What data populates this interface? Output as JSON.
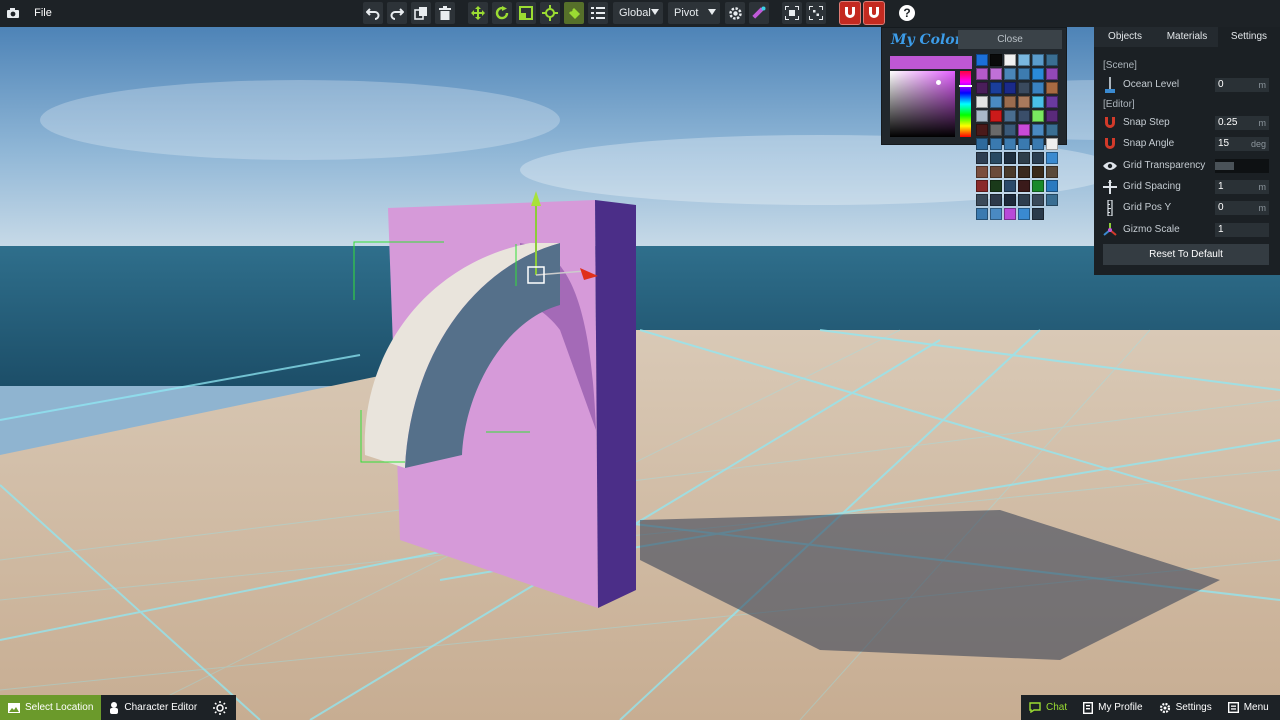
{
  "topbar": {
    "file_label": "File",
    "coord_space": "Global",
    "pivot_mode": "Pivot",
    "help_label": "?"
  },
  "colors_panel": {
    "title": "My Colors",
    "close_label": "Close",
    "current_color": "#be57d4",
    "swatches": [
      "#1b6fd8",
      "#0a0a0a",
      "#f2f2f2",
      "#7ab8e0",
      "#5a9ccc",
      "#3a6e92",
      "#b35ac8",
      "#c070d8",
      "#4a86b8",
      "#3d7cb0",
      "#2a8ad8",
      "#9248b8",
      "#4a1e5a",
      "#1a3e9c",
      "#1a2a8a",
      "#3a4a5e",
      "#3a82c0",
      "#a86a42",
      "#e4e4e4",
      "#4a8ac2",
      "#9a6c4e",
      "#a87a5c",
      "#4ac0e8",
      "#6a3aa0",
      "#a8b8c8",
      "#cc1a1a",
      "#4a6e90",
      "#3a4e6a",
      "#7ae860",
      "#5a2a7a",
      "#4a1a1a",
      "#6a6a6a",
      "#3a5a7a",
      "#c84ad8",
      "#4a8ac2",
      "#3a6e92",
      "#2e6a9c",
      "#3a7ab0",
      "#3d7cb0",
      "#3a7ab0",
      "#3a7ab0",
      "#eeeeee",
      "#2e3e52",
      "#2a4a62",
      "#1e2e3e",
      "#2e3e4a",
      "#2a3e52",
      "#3a8ad0",
      "#7a4e3e",
      "#6a4a3a",
      "#4a3a2a",
      "#3a2a1e",
      "#3a2a1a",
      "#5a4a3a",
      "#8a2a2a",
      "#1a3a1a",
      "#2a4a6a",
      "#3a1a1a",
      "#1a8a2a",
      "#2a7ac0",
      "#3a4a5a",
      "#2e3a4a",
      "#1e2a3a",
      "#2e3e4e",
      "#3a4a5a",
      "#3a6e92",
      "#3a7ab0",
      "#4a8ac2",
      "#b84ad8",
      "#3a8ad0",
      "#2a3a4a",
      ""
    ]
  },
  "settings_panel": {
    "tabs": [
      "Objects",
      "Materials",
      "Settings"
    ],
    "active_tab": "Settings",
    "section_scene": "[Scene]",
    "section_editor": "[Editor]",
    "ocean_level": {
      "label": "Ocean Level",
      "value": "0",
      "unit": "m"
    },
    "snap_step": {
      "label": "Snap Step",
      "value": "0.25",
      "unit": "m"
    },
    "snap_angle": {
      "label": "Snap Angle",
      "value": "15",
      "unit": "deg"
    },
    "grid_transparency": {
      "label": "Grid Transparency",
      "value": 0.35
    },
    "grid_spacing": {
      "label": "Grid Spacing",
      "value": "1",
      "unit": "m"
    },
    "grid_pos_y": {
      "label": "Grid Pos Y",
      "value": "0",
      "unit": "m"
    },
    "gizmo_scale": {
      "label": "Gizmo Scale",
      "value": "1"
    },
    "reset_label": "Reset To Default"
  },
  "bottom_left": {
    "select_location": "Select Location",
    "character_editor": "Character Editor"
  },
  "bottom_right": {
    "chat": "Chat",
    "my_profile": "My Profile",
    "settings": "Settings",
    "menu": "Menu"
  }
}
